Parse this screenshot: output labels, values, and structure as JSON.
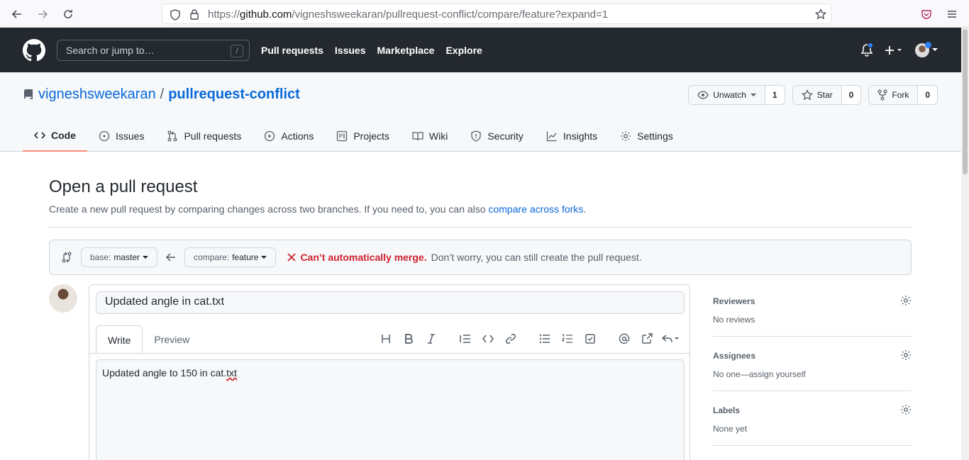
{
  "browser": {
    "url_prefix": "https://",
    "url_host": "github.com",
    "url_path": "/vigneshsweekaran/pullrequest-conflict/compare/feature?expand=1"
  },
  "header": {
    "search_placeholder": "Search or jump to…",
    "slash_hint": "/",
    "nav": [
      "Pull requests",
      "Issues",
      "Marketplace",
      "Explore"
    ]
  },
  "repo": {
    "owner": "vigneshsweekaran",
    "separator": "/",
    "name": "pullrequest-conflict",
    "watch": {
      "label": "Unwatch",
      "count": "1"
    },
    "star": {
      "label": "Star",
      "count": "0"
    },
    "fork": {
      "label": "Fork",
      "count": "0"
    }
  },
  "tabs": [
    "Code",
    "Issues",
    "Pull requests",
    "Actions",
    "Projects",
    "Wiki",
    "Security",
    "Insights",
    "Settings"
  ],
  "page": {
    "title": "Open a pull request",
    "subtitle": "Create a new pull request by comparing changes across two branches. If you need to, you can also ",
    "subtitle_link": "compare across forks",
    "subtitle_end": "."
  },
  "range": {
    "base_label": "base:",
    "base_value": "master",
    "compare_label": "compare:",
    "compare_value": "feature",
    "merge_status": "Can’t automatically merge.",
    "merge_note": "Don’t worry, you can still create the pull request."
  },
  "composer": {
    "title_value": "Updated angle in cat.txt",
    "tab_write": "Write",
    "tab_preview": "Preview",
    "body_text": "Updated angle to 150 in cat.",
    "body_spell": "txt"
  },
  "sidebar": {
    "reviewers_title": "Reviewers",
    "reviewers_value": "No reviews",
    "assignees_title": "Assignees",
    "assignees_value": "No one—assign yourself",
    "labels_title": "Labels",
    "labels_value": "None yet"
  },
  "colors": {
    "accent": "#0969da",
    "header_bg": "#24292f",
    "error": "#cf222e",
    "tab_underline": "#fd8c73"
  }
}
